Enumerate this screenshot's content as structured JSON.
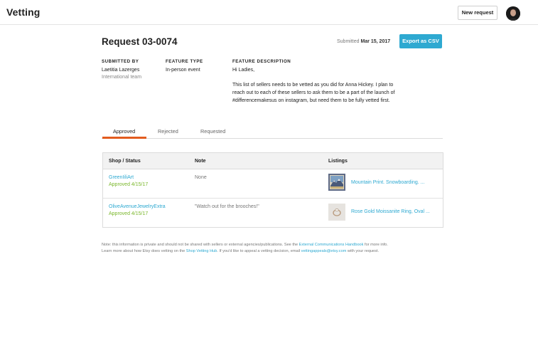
{
  "header": {
    "app_title": "Vetting",
    "new_request_label": "New request",
    "avatar_icon": "user-avatar"
  },
  "request": {
    "title": "Request 03-0074",
    "submitted_prefix": "Submitted",
    "submitted_date": "Mar 15, 2017",
    "export_label": "Export as CSV"
  },
  "meta": {
    "submitted_by_label": "SUBMITTED BY",
    "submitted_by_name": "Laetitia Lazerges",
    "submitted_by_team": "International team",
    "feature_type_label": "FEATURE TYPE",
    "feature_type_value": "In-person event",
    "feature_description_label": "FEATURE DESCRIPTION",
    "description_lines": [
      "Hi Ladies,",
      "This list of sellers needs to be vetted as you did for Anna Hickey. I plan to",
      "reach out to each of these sellers to ask them to be a part of the launch of",
      "#differencemakesus on instagram, but need them to be fully vetted first."
    ]
  },
  "tabs": [
    {
      "label": "Approved",
      "active": true
    },
    {
      "label": "Rejected",
      "active": false
    },
    {
      "label": "Requested",
      "active": false
    }
  ],
  "table": {
    "headers": [
      "Shop / Status",
      "Note",
      "Listings"
    ],
    "rows": [
      {
        "shop": "GreenIiliArt",
        "status": "Approved 4/15/17",
        "note": "None",
        "listing": "Mountain Print. Snowboarding. ...",
        "thumb_icon": "mountain-print-thumbnail"
      },
      {
        "shop": "OliveAvenueJewelryExtra",
        "status": "Approved 4/15/17",
        "note": "\"Watch out for the brooches!\"",
        "listing": "Rose Gold Moissanite Ring, Oval ...",
        "thumb_icon": "ring-thumbnail"
      }
    ]
  },
  "footer": {
    "line1_a": "Note: this information is private and should not be shared with sellers or external agencies/publications. See the ",
    "line1_link": "External Communications Handbook",
    "line1_b": " for more info.",
    "line2_a": "Learn more about how Etsy does vetting on the ",
    "line2_link1": "Shop Vetting Hub",
    "line2_b": ". If you'd like to appeal a vetting decision, email ",
    "line2_link2": "vettingappeals@etsy.com",
    "line2_c": " with your request."
  },
  "colors": {
    "accent_blue": "#2ea9d1",
    "tab_underline": "#e25c1e",
    "approved_green": "#7ab72b"
  }
}
